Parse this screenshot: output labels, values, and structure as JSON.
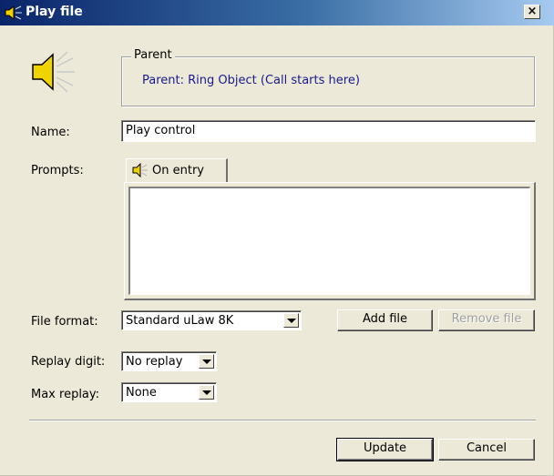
{
  "window": {
    "title": "Play file",
    "close_label": "×"
  },
  "parent": {
    "group_label": "Parent",
    "text": "Parent: Ring Object (Call starts here)"
  },
  "name": {
    "label": "Name:",
    "value": "Play control"
  },
  "prompts": {
    "label": "Prompts:",
    "tab_label": "On entry",
    "items": []
  },
  "file_format": {
    "label": "File format:",
    "value": "Standard uLaw 8K"
  },
  "buttons": {
    "add_file": "Add file",
    "remove_file": "Remove file",
    "update": "Update",
    "cancel": "Cancel"
  },
  "replay_digit": {
    "label": "Replay digit:",
    "value": "No replay"
  },
  "max_replay": {
    "label": "Max replay:",
    "value": "None"
  },
  "icons": {
    "title": "speaker-icon",
    "big": "speaker-icon",
    "tab": "speaker-icon"
  },
  "colors": {
    "title_bar_start": "#0a246a",
    "title_bar_end": "#a6caf0",
    "dialog_bg": "#ece9d8",
    "parent_text": "#1a1a8c"
  }
}
